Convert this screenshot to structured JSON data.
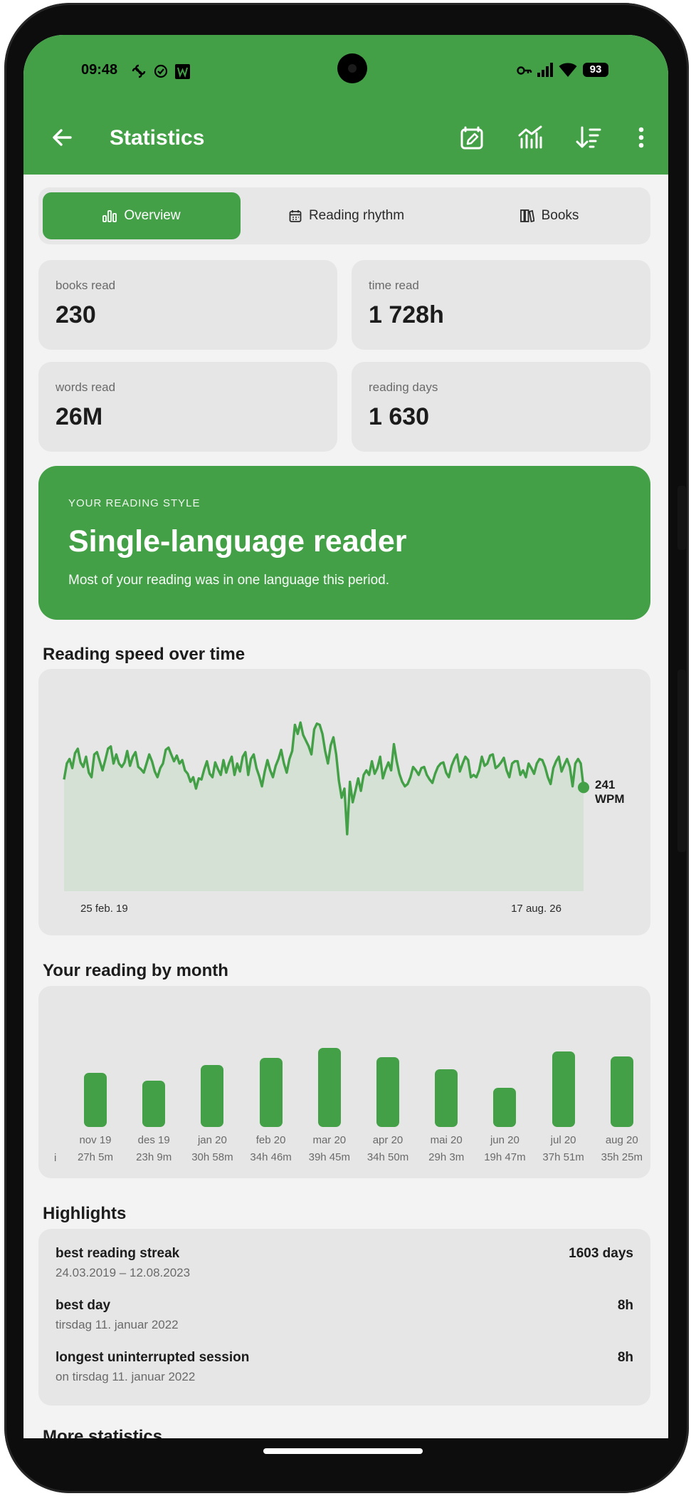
{
  "status_bar": {
    "time": "09:48",
    "battery": "93"
  },
  "toolbar": {
    "title": "Statistics",
    "icons": [
      "back-arrow-icon",
      "edit-goals-icon",
      "chart-icon",
      "sort-icon",
      "more-vert-icon"
    ]
  },
  "tabs": [
    {
      "label": "Overview",
      "icon": "bar-chart-icon",
      "active": true
    },
    {
      "label": "Reading rhythm",
      "icon": "calendar-icon",
      "active": false
    },
    {
      "label": "Books",
      "icon": "books-icon",
      "active": false
    }
  ],
  "stats": [
    {
      "label": "books read",
      "value": "230"
    },
    {
      "label": "time read",
      "value": "1 728h"
    },
    {
      "label": "words read",
      "value": "26M"
    },
    {
      "label": "reading days",
      "value": "1 630"
    }
  ],
  "reading_style": {
    "eyebrow": "YOUR READING STYLE",
    "title": "Single-language reader",
    "description": "Most of your reading was in one language this period."
  },
  "speed_section": {
    "title": "Reading speed over time",
    "start_label": "25 feb. 19",
    "end_label": "17 aug. 26",
    "current_value": "241",
    "current_unit": "WPM"
  },
  "month_section": {
    "title": "Your reading by month"
  },
  "highlights": {
    "title": "Highlights",
    "items": [
      {
        "title": "best reading streak",
        "sub": "24.03.2019 – 12.08.2023",
        "value": "1603 days"
      },
      {
        "title": "best day",
        "sub": "tirsdag 11. januar 2022",
        "value": "8h"
      },
      {
        "title": "longest uninterrupted session",
        "sub": "on tirsdag 11. januar 2022",
        "value": "8h"
      }
    ]
  },
  "next_section": {
    "title": "More statistics"
  },
  "colors": {
    "accent": "#43a047",
    "card": "#e6e6e6",
    "background": "#f3f3f3"
  },
  "chart_data": [
    {
      "type": "line",
      "title": "Reading speed over time",
      "x_start": "25 feb. 19",
      "x_end": "17 aug. 26",
      "y_unit": "WPM",
      "last_value": 241,
      "ylim": [
        150,
        320
      ],
      "values": [
        248,
        262,
        266,
        258,
        271,
        275,
        263,
        259,
        268,
        254,
        250,
        270,
        272,
        264,
        256,
        265,
        275,
        277,
        262,
        270,
        262,
        259,
        263,
        273,
        260,
        268,
        272,
        259,
        257,
        254,
        262,
        270,
        264,
        255,
        250,
        258,
        262,
        274,
        276,
        270,
        264,
        269,
        262,
        265,
        256,
        253,
        246,
        250,
        240,
        249,
        248,
        257,
        264,
        253,
        250,
        263,
        257,
        252,
        265,
        254,
        262,
        268,
        252,
        262,
        255,
        268,
        272,
        252,
        266,
        270,
        258,
        251,
        242,
        255,
        265,
        256,
        250,
        260,
        266,
        274,
        262,
        254,
        266,
        273,
        296,
        288,
        298,
        287,
        282,
        277,
        270,
        292,
        297,
        296,
        288,
        273,
        262,
        278,
        285,
        270,
        247,
        232,
        240,
        200,
        246,
        228,
        238,
        249,
        238,
        252,
        256,
        252,
        264,
        253,
        258,
        268,
        249,
        257,
        263,
        256,
        279,
        264,
        253,
        246,
        242,
        244,
        250,
        259,
        256,
        252,
        258,
        259,
        252,
        248,
        245,
        253,
        259,
        262,
        263,
        254,
        250,
        260,
        266,
        270,
        255,
        262,
        268,
        265,
        250,
        252,
        250,
        256,
        268,
        260,
        262,
        269,
        270,
        258,
        260,
        263,
        267,
        256,
        250,
        262,
        264,
        264,
        252,
        256,
        250,
        262,
        258,
        253,
        262,
        266,
        265,
        259,
        250,
        244,
        258,
        264,
        268,
        255,
        261,
        266,
        259,
        242,
        262,
        266,
        262,
        241
      ]
    },
    {
      "type": "bar",
      "title": "Your reading by month",
      "categories": [
        "nov 19",
        "des 19",
        "jan 20",
        "feb 20",
        "mar 20",
        "apr 20",
        "mai 20",
        "jun 20",
        "jul 20",
        "aug 20"
      ],
      "value_labels": [
        "27h 5m",
        "23h 9m",
        "30h 58m",
        "34h 46m",
        "39h 45m",
        "34h 50m",
        "29h 3m",
        "19h 47m",
        "37h 51m",
        "35h 25m"
      ],
      "values": [
        27.08,
        23.15,
        30.97,
        34.77,
        39.75,
        34.83,
        29.05,
        19.78,
        37.85,
        35.42
      ],
      "unit": "hours"
    }
  ]
}
